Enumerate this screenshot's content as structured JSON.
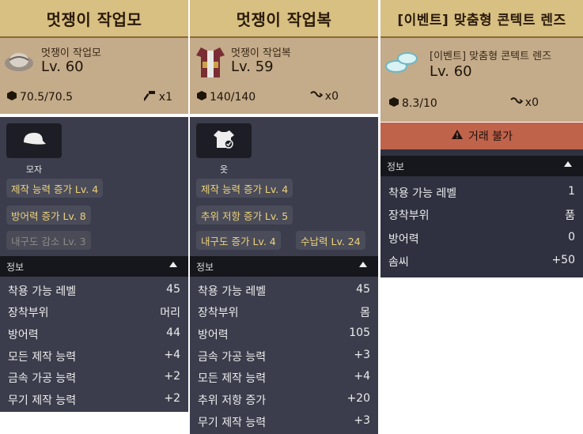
{
  "cards": [
    {
      "title": "멋쟁이 작업모",
      "item_name": "멋쟁이 작업모",
      "level": "Lv. 60",
      "weight": "70.5/70.5",
      "right_stat": "x1",
      "right_icon": "hammer-icon",
      "slot_label": "모자",
      "slot_icon": "cap-icon",
      "chips": [
        "제작 능력 증가 Lv. 4",
        "방어력 증가 Lv. 8",
        "내구도 감소 Lv. 3"
      ],
      "info_header": "정보",
      "info": [
        {
          "k": "착용 가능 레벨",
          "v": "45"
        },
        {
          "k": "장착부위",
          "v": "머리"
        },
        {
          "k": "방어력",
          "v": "44"
        },
        {
          "k": "모든 제작 능력",
          "v": "+4"
        },
        {
          "k": "금속 가공 능력",
          "v": "+2"
        },
        {
          "k": "무기 제작 능력",
          "v": "+2"
        }
      ]
    },
    {
      "title": "멋쟁이 작업복",
      "item_name": "멋쟁이 작업복",
      "level": "Lv. 59",
      "weight": "140/140",
      "right_stat": "x0",
      "right_icon": "repair-icon",
      "slot_label": "옷",
      "slot_icon": "shirt-icon",
      "chips": [
        "제작 능력 증가 Lv. 4",
        "추위 저항 증가 Lv. 5",
        "내구도 증가 Lv. 4",
        "수납력 Lv. 24"
      ],
      "info_header": "정보",
      "info": [
        {
          "k": "착용 가능 레벨",
          "v": "45"
        },
        {
          "k": "장착부위",
          "v": "몸"
        },
        {
          "k": "방어력",
          "v": "105"
        },
        {
          "k": "금속 가공 능력",
          "v": "+3"
        },
        {
          "k": "모든 제작 능력",
          "v": "+4"
        },
        {
          "k": "추위 저항 증가",
          "v": "+20"
        },
        {
          "k": "무기 제작 능력",
          "v": "+3"
        }
      ]
    },
    {
      "title": "[이벤트] 맞춤형 콘텍트 렌즈",
      "item_name": "[이벤트] 맞춤형 콘텍트 렌즈",
      "level": "Lv. 60",
      "weight": "8.3/10",
      "right_stat": "x0",
      "right_icon": "repair-icon",
      "warning": "거래 불가",
      "info_header": "정보",
      "info": [
        {
          "k": "착용 가능 레벨",
          "v": "1"
        },
        {
          "k": "장착부위",
          "v": "품"
        },
        {
          "k": "방어력",
          "v": "0"
        },
        {
          "k": "솜씨",
          "v": "+50"
        }
      ]
    }
  ],
  "colors": {
    "header": "#d8bf82",
    "summary": "#c4ab8a",
    "panel": "#3b3d4c",
    "chip_text": "#ecd27a",
    "warning": "#c0634b"
  }
}
